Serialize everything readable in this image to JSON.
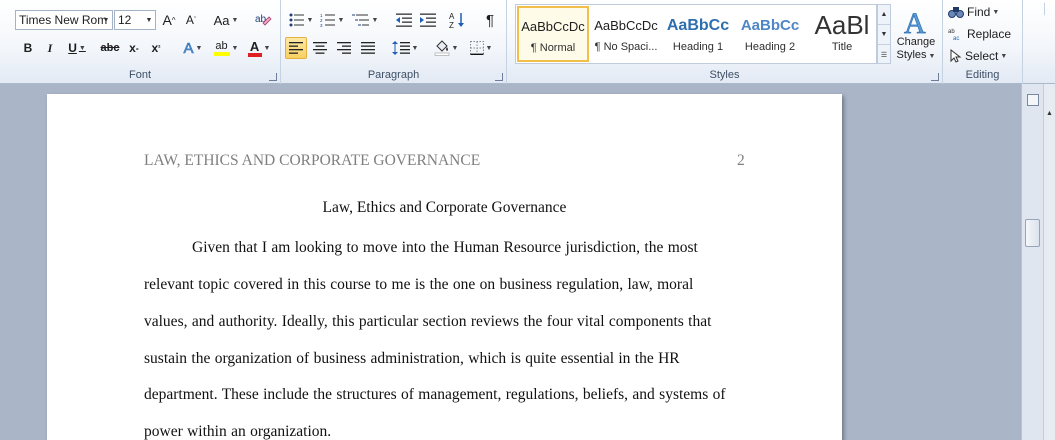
{
  "font_group": {
    "label": "Font",
    "font_name": "Times New Rom",
    "font_size": "12",
    "grow_label": "A",
    "shrink_label": "A",
    "case_label": "Aa",
    "bold_label": "B",
    "italic_label": "I",
    "underline_label": "U",
    "strike_label": "abc",
    "subscript_label": "x",
    "superscript_label": "x",
    "effects_label": "A",
    "highlight_label": "ab",
    "font_color_label": "A",
    "font_color": "#e02020",
    "highlight_color": "#ffff00"
  },
  "paragraph_group": {
    "label": "Paragraph",
    "pilcrow": "¶"
  },
  "styles_group": {
    "label": "Styles",
    "tiles": [
      {
        "preview": "AaBbCcDc",
        "name": "¶ Normal"
      },
      {
        "preview": "AaBbCcDc",
        "name": "¶ No Spaci..."
      },
      {
        "preview": "AaBbCc",
        "name": "Heading 1"
      },
      {
        "preview": "AaBbCc",
        "name": "Heading 2"
      },
      {
        "preview": "AaBl",
        "name": "Title"
      }
    ],
    "change_styles_line1": "Change",
    "change_styles_line2": "Styles"
  },
  "editing_group": {
    "label": "Editing",
    "find_label": "Find",
    "replace_label": "Replace",
    "select_label": "Select"
  },
  "document": {
    "header_left": "LAW, ETHICS AND CORPORATE GOVERNANCE",
    "header_right": "2",
    "title": "Law, Ethics and Corporate Governance",
    "lines": [
      "Given that I am looking to move into the Human Resource jurisdiction, the most",
      "relevant topic covered in this course to me is the one on business regulation, law, moral",
      "values, and authority. Ideally, this particular section reviews the four vital components that",
      "sustain the organization of business administration, which is quite essential in the HR",
      "department. These include the structures of management, regulations, beliefs, and systems of",
      "power within an organization."
    ]
  }
}
